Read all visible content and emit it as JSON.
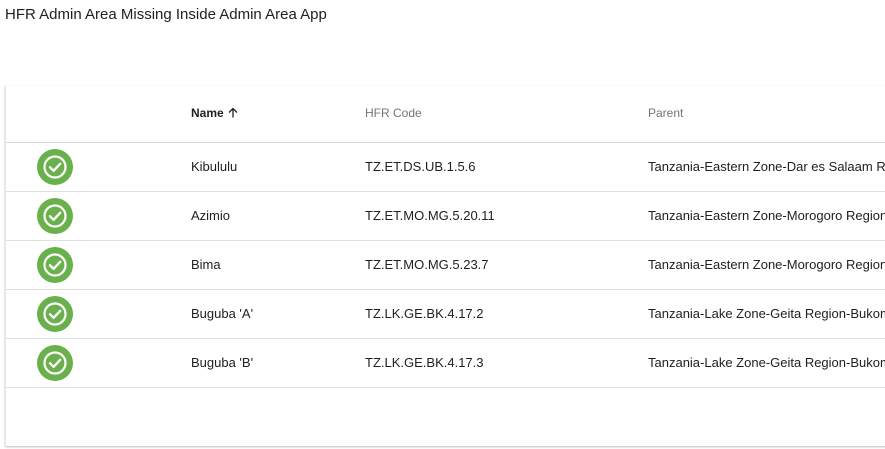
{
  "page": {
    "title": "HFR Admin Area Missing Inside Admin Area App"
  },
  "table": {
    "columns": {
      "name": "Name",
      "code": "HFR Code",
      "parent": "Parent"
    },
    "sort": {
      "column": "name",
      "direction": "ascending",
      "icon": "arrow-up-icon"
    },
    "status_icon": "check-circle-icon",
    "status_color": "#6ab04c",
    "rows": [
      {
        "name": "Kibululu",
        "code": "TZ.ET.DS.UB.1.5.6",
        "parent": "Tanzania-Eastern Zone-Dar es Salaam Re"
      },
      {
        "name": "Azimio",
        "code": "TZ.ET.MO.MG.5.20.11",
        "parent": "Tanzania-Eastern Zone-Morogoro Region-"
      },
      {
        "name": "Bima",
        "code": "TZ.ET.MO.MG.5.23.7",
        "parent": "Tanzania-Eastern Zone-Morogoro Region-"
      },
      {
        "name": "Buguba 'A'",
        "code": "TZ.LK.GE.BK.4.17.2",
        "parent": "Tanzania-Lake Zone-Geita Region-Bukoml"
      },
      {
        "name": "Buguba 'B'",
        "code": "TZ.LK.GE.BK.4.17.3",
        "parent": "Tanzania-Lake Zone-Geita Region-Bukoml"
      }
    ]
  }
}
